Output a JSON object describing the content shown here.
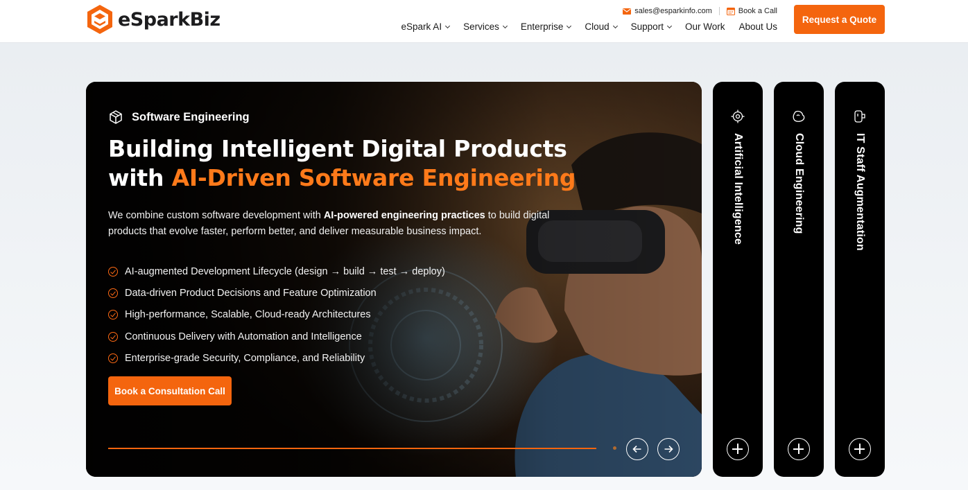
{
  "brand": {
    "name": "eSparkBiz",
    "accent": "#f4650e"
  },
  "top_links": {
    "email": "sales@esparkinfo.com",
    "call": "Book a Call"
  },
  "nav": {
    "items": [
      {
        "label": "eSpark AI",
        "dropdown": true
      },
      {
        "label": "Services",
        "dropdown": true
      },
      {
        "label": "Enterprise",
        "dropdown": true
      },
      {
        "label": "Cloud",
        "dropdown": true
      },
      {
        "label": "Support",
        "dropdown": true
      },
      {
        "label": "Our Work",
        "dropdown": false
      },
      {
        "label": "About Us",
        "dropdown": false
      }
    ],
    "quote_label": "Request a Quote"
  },
  "hero": {
    "eyebrow": "Software Engineering",
    "headline_line1": "Building Intelligent Digital Products",
    "headline_with": "with ",
    "headline_accent": "AI-Driven Software Engineering",
    "lead_before": "We combine custom software development with ",
    "lead_bold": "AI-powered engineering practices",
    "lead_after": " to build digital products that evolve faster, perform better, and deliver measurable business impact.",
    "bullets": [
      "AI-augmented Development Lifecycle (design → build → test → deploy)",
      "Data-driven Product Decisions and Feature Optimization",
      "High-performance, Scalable, Cloud-ready Architectures",
      "Continuous Delivery with Automation and Intelligence",
      "Enterprise-grade Security, Compliance, and Reliability"
    ],
    "cta_label": "Book a Consultation Call"
  },
  "side_cards": [
    {
      "label": "Artificial Intelligence",
      "icon": "chip-icon"
    },
    {
      "label": "Cloud Engineering",
      "icon": "cloud-icon"
    },
    {
      "label": "IT Staff Augmentation",
      "icon": "staff-icon"
    }
  ]
}
